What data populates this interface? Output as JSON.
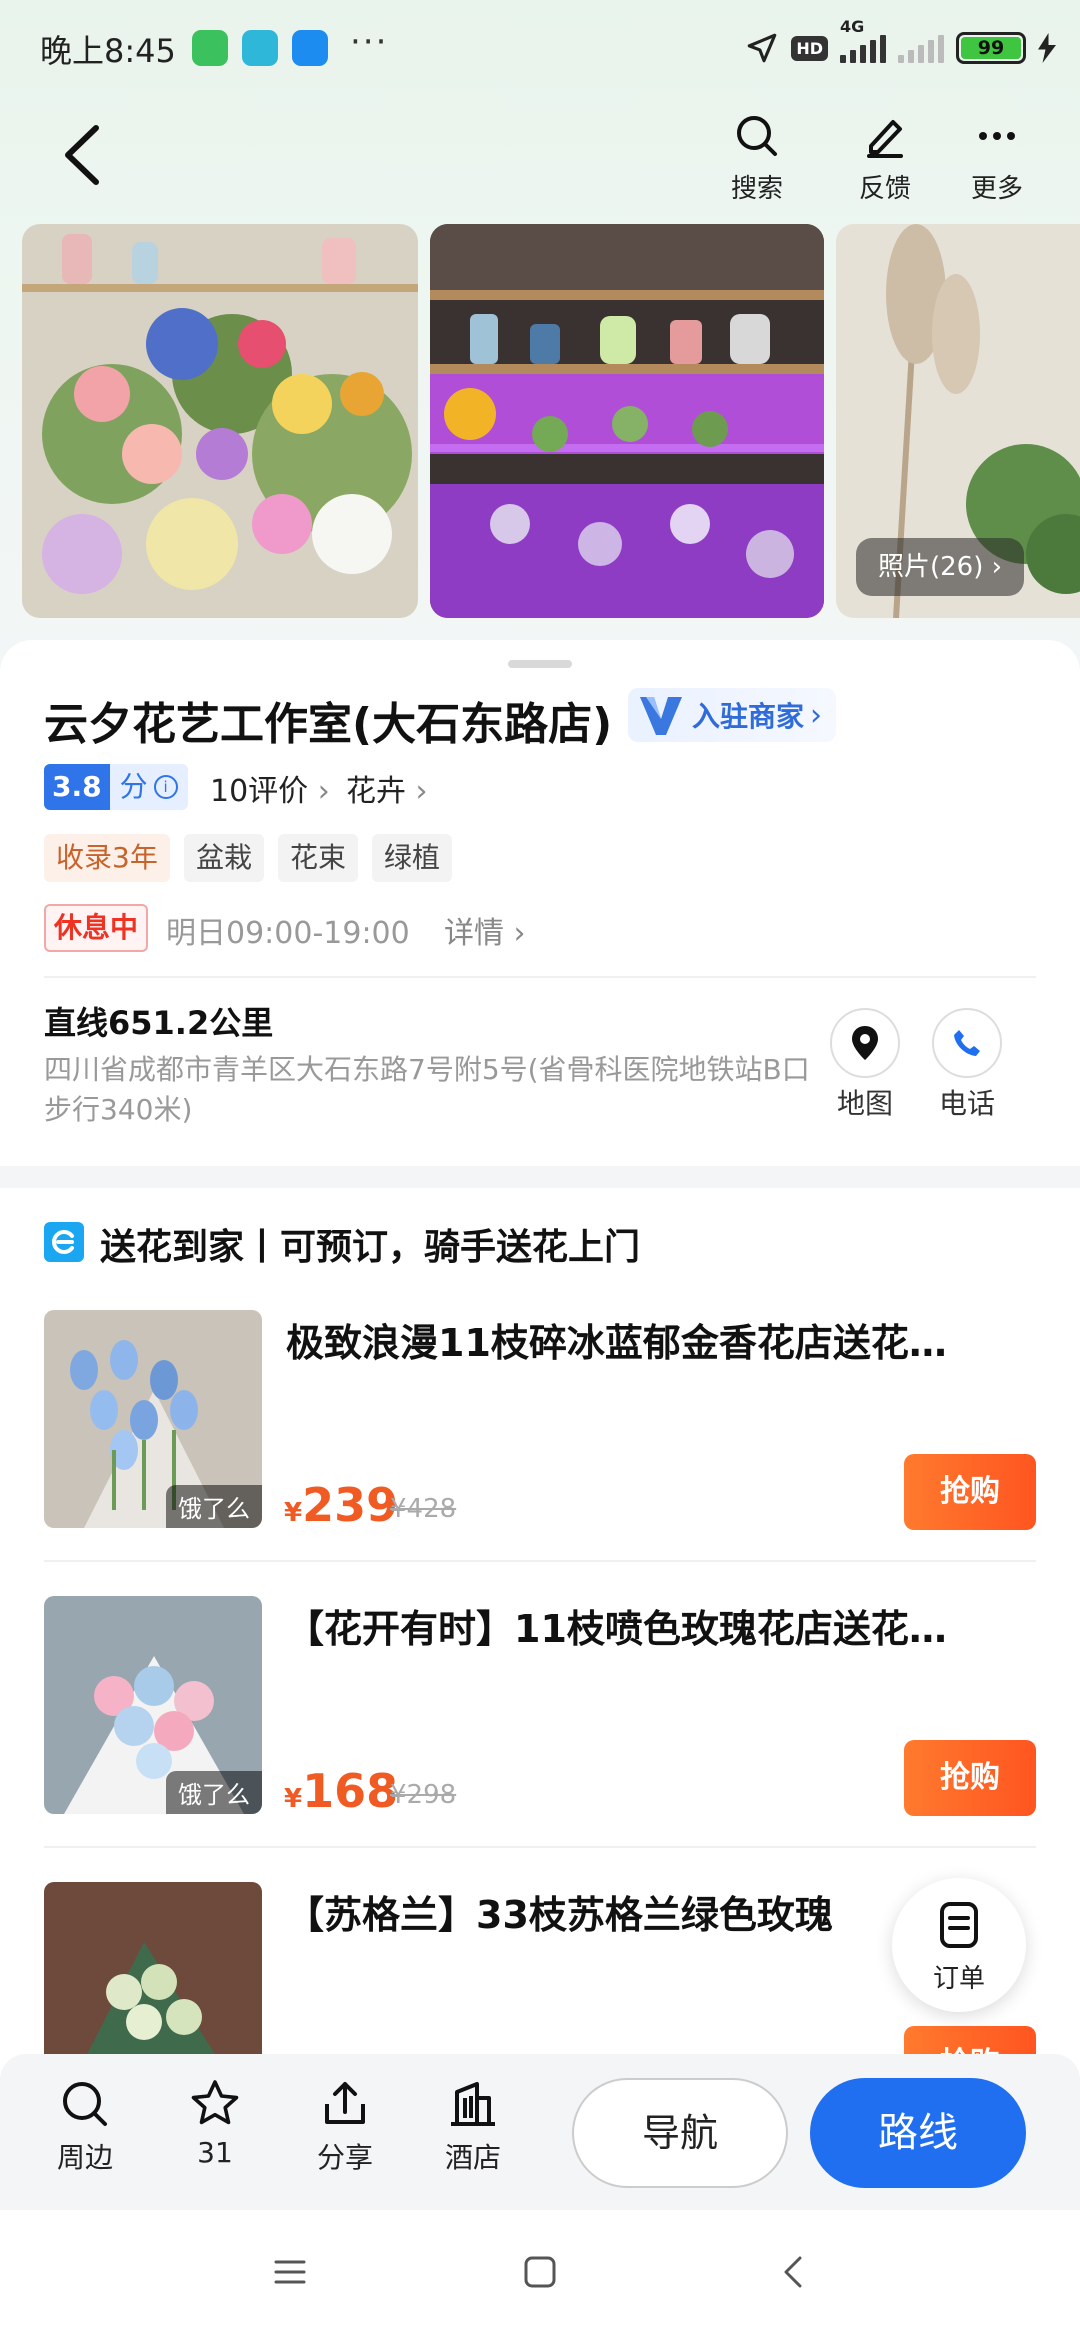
{
  "status_bar": {
    "time": "晚上8:45",
    "more": "···",
    "network": "4G",
    "hd": "HD",
    "battery": "99"
  },
  "header": {
    "search_label": "搜索",
    "feedback_label": "反馈",
    "more_label": "更多"
  },
  "photos": {
    "count_label": "照片(26)"
  },
  "shop": {
    "name": "云夕花艺工作室(大石东路店)",
    "merchant_badge": "入驻商家",
    "rating": "3.8",
    "rating_unit": "分",
    "reviews": "10评价",
    "category": "花卉",
    "tags": [
      "收录3年",
      "盆栽",
      "花束",
      "绿植"
    ],
    "status": "休息中",
    "hours": "明日09:00-19:00",
    "details": "详情",
    "distance": "直线651.2公里",
    "address": "四川省成都市青羊区大石东路7号附5号(省骨科医院地铁站B口步行340米)",
    "map_label": "地图",
    "phone_label": "电话"
  },
  "delivery": {
    "title": "送花到家丨可预订，骑手送花上门",
    "products": [
      {
        "name": "极致浪漫11枝碎冰蓝郁金香花店送花…",
        "badge": "饿了么",
        "currency": "¥",
        "price": "239",
        "original_price": "¥428",
        "buy_label": "抢购"
      },
      {
        "name": "【花开有时】11枝喷色玫瑰花店送花…",
        "badge": "饿了么",
        "currency": "¥",
        "price": "168",
        "original_price": "¥298",
        "buy_label": "抢购"
      },
      {
        "name": "【苏格兰】33枝苏格兰绿色玫瑰",
        "buy_label": "抢购"
      }
    ]
  },
  "order_fab": {
    "label": "订单"
  },
  "bottom_bar": {
    "nearby": "周边",
    "favorites": "31",
    "share": "分享",
    "hotel": "酒店",
    "navigate": "导航",
    "route": "路线"
  }
}
